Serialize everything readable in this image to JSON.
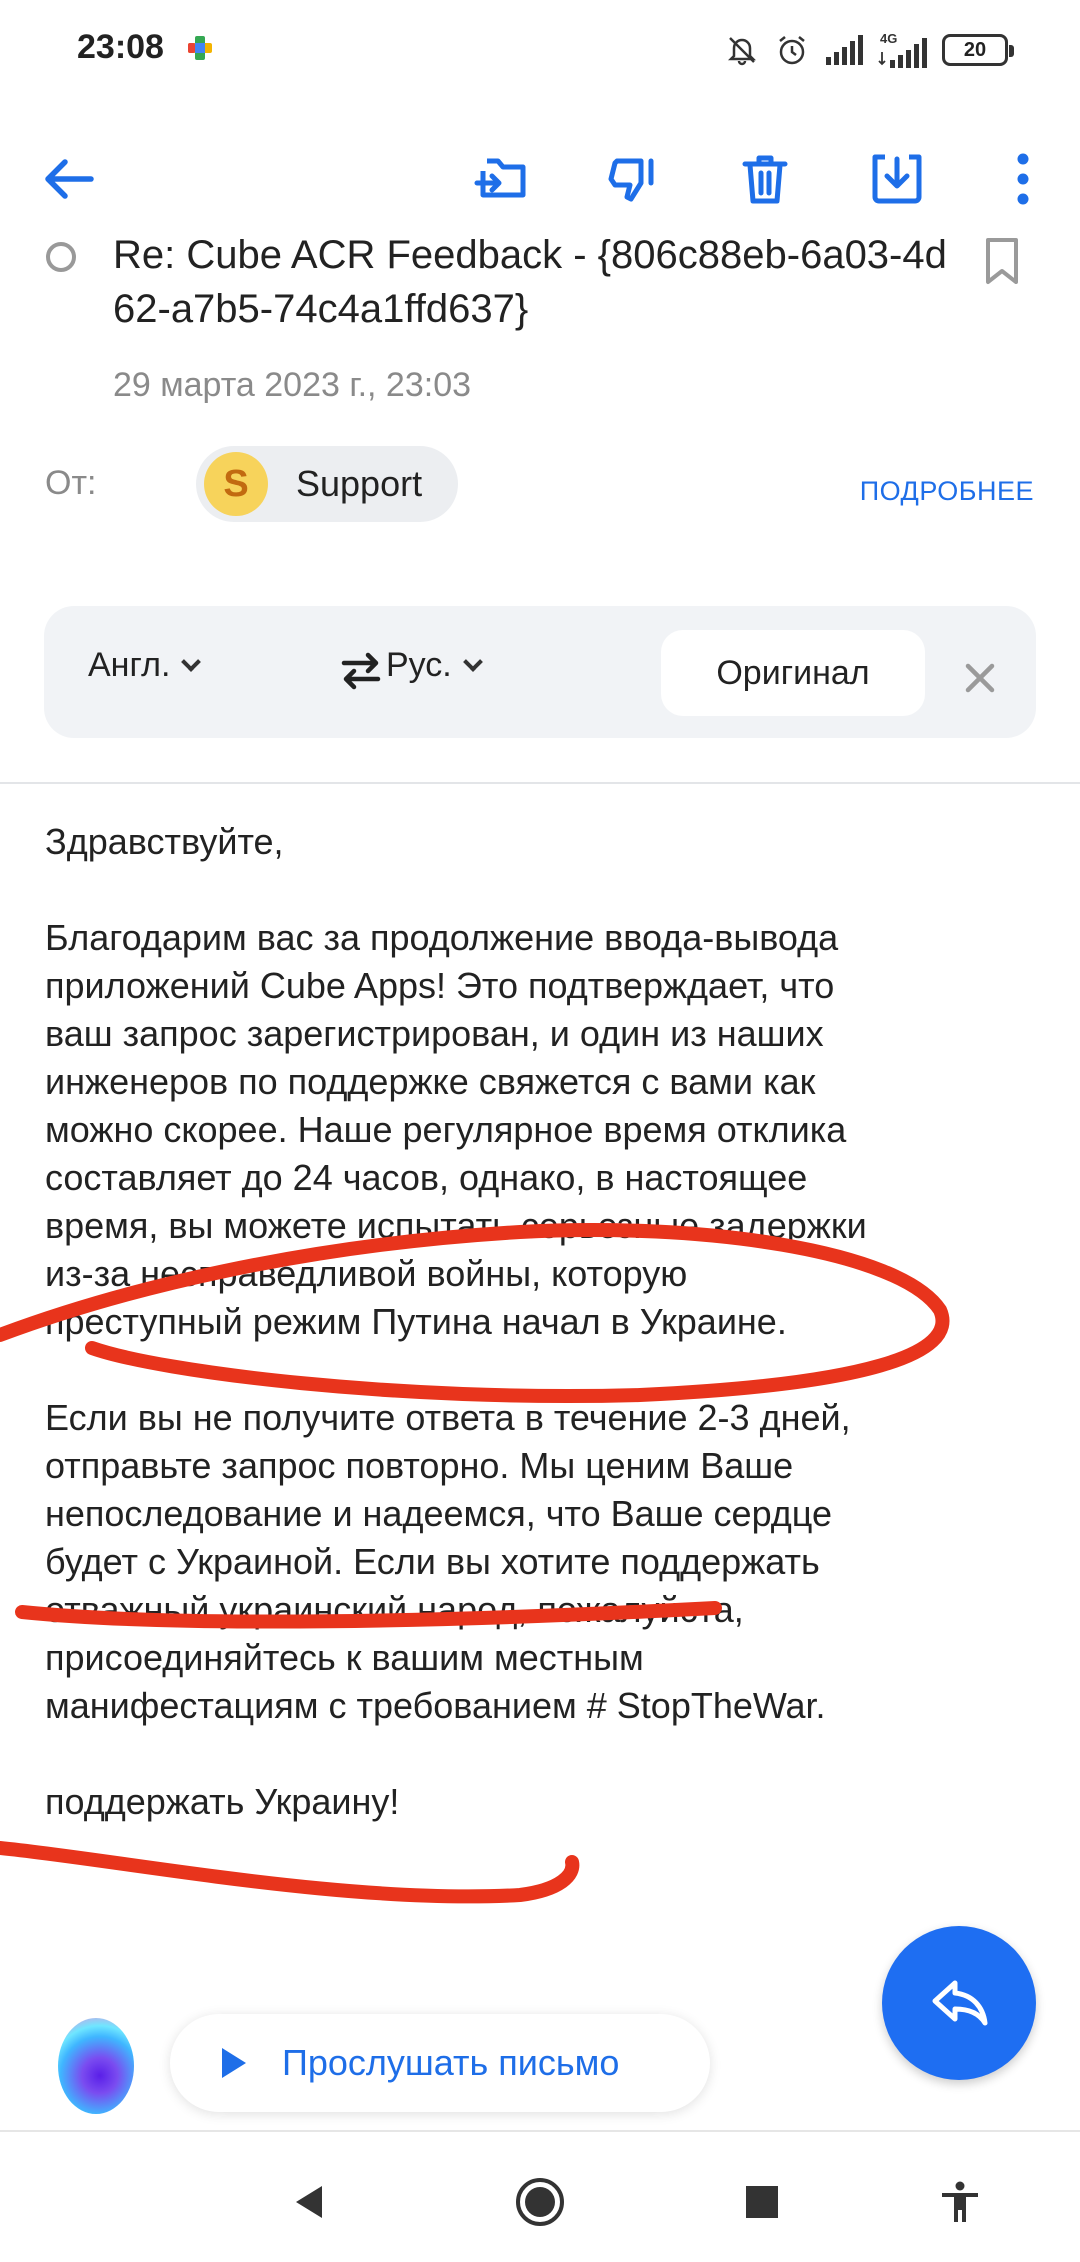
{
  "status_bar": {
    "time": "23:08",
    "network_label": "4G",
    "battery": "20",
    "icons": [
      "app-notification-icon",
      "mute-icon",
      "alarm-icon",
      "signal-icon",
      "signal-4g-icon",
      "battery-icon"
    ]
  },
  "toolbar": {
    "icons": [
      "back-arrow-icon",
      "move-to-folder-icon",
      "spam-dislike-icon",
      "trash-icon",
      "archive-download-icon",
      "more-vert-icon"
    ]
  },
  "email": {
    "subject": "Re: Cube ACR Feedback - {806c88eb-6a03-4d62-a7b5-74c4a1ffd637}",
    "date": "29 марта 2023 г., 23:03",
    "from_label": "От:",
    "sender_initial": "S",
    "sender_name": "Support",
    "details_link": "ПОДРОБНЕЕ"
  },
  "translation": {
    "source_lang": "Англ.",
    "target_lang": "Рус.",
    "original_button": "Оригинал"
  },
  "body": {
    "greeting": "Здравствуйте,",
    "paragraph_1": "Благодарим вас за продолжение ввода-вывода\nприложений Cube Apps! Это подтверждает, что\nваш запрос зарегистрирован, и один из наших\nинженеров по поддержке свяжется с вами как\nможно скорее. Наше регулярное время отклика\nсоставляет до 24 часов, однако, в настоящее\nвремя, вы можете испытать серьезные задержки\nиз-за несправедливой войны, которую\nпреступный режим Путина начал в Украине.",
    "paragraph_2": "Если вы не получите ответа в течение 2-3 дней,\nотправьте запрос повторно. Мы ценим Ваше\nнепоследование и надеемся, что Ваше сердце\nбудет с Украиной. Если вы хотите поддержать\nотважный украинский народ, пожалуйста,\nприсоединяйтесь к вашим местным\nманифестациям с требованием # StopTheWar.",
    "closing": "поддержать Украину!"
  },
  "listen": {
    "label": "Прослушать письмо"
  },
  "colors": {
    "accent": "#1e6ee8",
    "scribble": "#e8341c",
    "avatar_bg": "#f7d35b"
  },
  "nav": {
    "icons": [
      "nav-back-icon",
      "nav-home-icon",
      "nav-recents-icon",
      "accessibility-icon"
    ]
  }
}
